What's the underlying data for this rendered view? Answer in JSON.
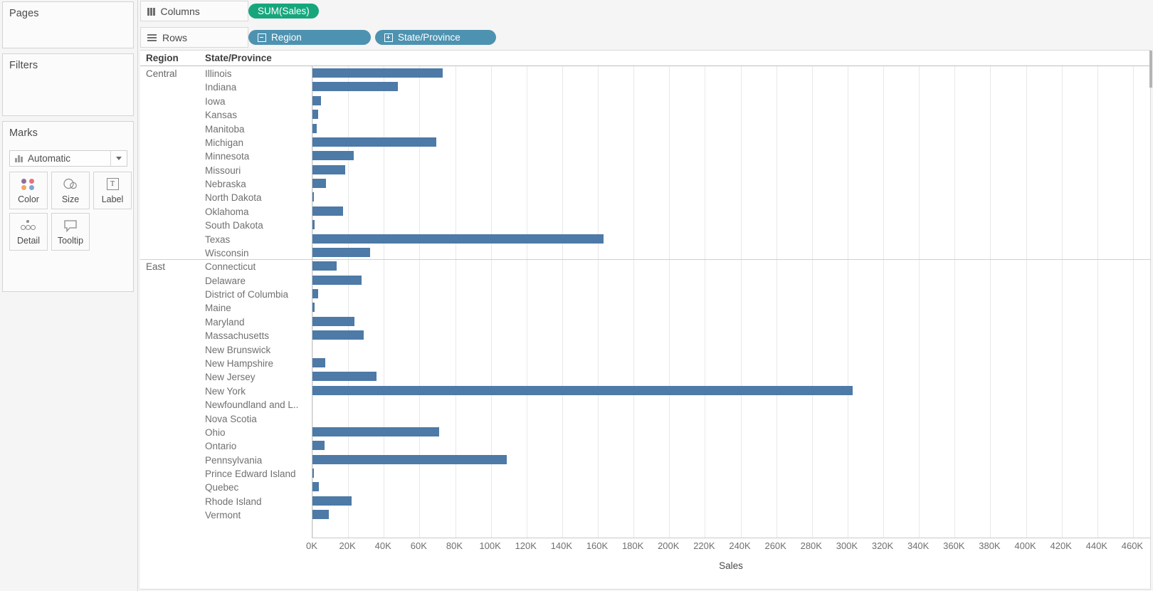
{
  "panel": {
    "pages_title": "Pages",
    "filters_title": "Filters",
    "marks_title": "Marks",
    "marks_type": "Automatic",
    "marks_type_icon": "bar-chart-icon",
    "mark_buttons": [
      {
        "label": "Color",
        "icon": "color-dots-icon"
      },
      {
        "label": "Size",
        "icon": "size-circles-icon"
      },
      {
        "label": "Label",
        "icon": "label-text-icon"
      },
      {
        "label": "Detail",
        "icon": "detail-dots-icon"
      },
      {
        "label": "Tooltip",
        "icon": "tooltip-bubble-icon"
      }
    ],
    "color_dots": [
      "#8d6e9e",
      "#e8717e",
      "#f0a868",
      "#7aa6d2"
    ]
  },
  "shelves": {
    "columns_label": "Columns",
    "columns_icon": "columns-icon",
    "rows_label": "Rows",
    "rows_icon": "rows-icon",
    "columns_pills": [
      {
        "text": "SUM(Sales)",
        "color": "#17a67c",
        "expander": "none"
      }
    ],
    "rows_pills": [
      {
        "text": "Region",
        "color": "#4d92b0",
        "expander": "minus"
      },
      {
        "text": "State/Province",
        "color": "#4d92b0",
        "expander": "plus"
      }
    ]
  },
  "headers": {
    "region": "Region",
    "state": "State/Province"
  },
  "chart_data": {
    "type": "bar",
    "title": "",
    "orientation": "horizontal",
    "xlabel": "Sales",
    "ylabel": "",
    "xlim": [
      0,
      470
    ],
    "units": "K",
    "grid": true,
    "legend": "none",
    "bar_color": "#4d7aa7",
    "tick_labels": [
      "0K",
      "20K",
      "40K",
      "60K",
      "80K",
      "100K",
      "120K",
      "140K",
      "160K",
      "180K",
      "200K",
      "220K",
      "240K",
      "260K",
      "280K",
      "300K",
      "320K",
      "340K",
      "360K",
      "380K",
      "400K",
      "420K",
      "440K",
      "460K"
    ],
    "tick_values": [
      0,
      20,
      40,
      60,
      80,
      100,
      120,
      140,
      160,
      180,
      200,
      220,
      240,
      260,
      280,
      300,
      320,
      340,
      360,
      380,
      400,
      420,
      440,
      460
    ],
    "groups": [
      {
        "region": "Central",
        "rows": [
          {
            "state": "Illinois",
            "value": 73.0
          },
          {
            "state": "Indiana",
            "value": 48.0
          },
          {
            "state": "Iowa",
            "value": 4.6
          },
          {
            "state": "Kansas",
            "value": 3.0
          },
          {
            "state": "Manitoba",
            "value": 2.2
          },
          {
            "state": "Michigan",
            "value": 69.5
          },
          {
            "state": "Minnesota",
            "value": 23.0
          },
          {
            "state": "Missouri",
            "value": 18.5
          },
          {
            "state": "Nebraska",
            "value": 7.5
          },
          {
            "state": "North Dakota",
            "value": 0.6
          },
          {
            "state": "Oklahoma",
            "value": 17.0
          },
          {
            "state": "South Dakota",
            "value": 1.3
          },
          {
            "state": "Texas",
            "value": 163.0
          },
          {
            "state": "Wisconsin",
            "value": 32.5
          }
        ]
      },
      {
        "region": "East",
        "rows": [
          {
            "state": "Connecticut",
            "value": 13.4
          },
          {
            "state": "Delaware",
            "value": 27.5
          },
          {
            "state": "District of Columbia",
            "value": 3.0
          },
          {
            "state": "Maine",
            "value": 1.2
          },
          {
            "state": "Maryland",
            "value": 23.7
          },
          {
            "state": "Massachusetts",
            "value": 28.6
          },
          {
            "state": "New Brunswick",
            "value": 0.0
          },
          {
            "state": "New Hampshire",
            "value": 7.3
          },
          {
            "state": "New Jersey",
            "value": 35.8
          },
          {
            "state": "New York",
            "value": 303.0
          },
          {
            "state": "Newfoundland and L..",
            "value": 0.0
          },
          {
            "state": "Nova Scotia",
            "value": 0.0
          },
          {
            "state": "Ohio",
            "value": 71.0
          },
          {
            "state": "Ontario",
            "value": 6.6
          },
          {
            "state": "Pennsylvania",
            "value": 109.0
          },
          {
            "state": "Prince Edward Island",
            "value": 0.5
          },
          {
            "state": "Quebec",
            "value": 3.4
          },
          {
            "state": "Rhode Island",
            "value": 22.0
          },
          {
            "state": "Vermont",
            "value": 9.0
          }
        ]
      }
    ]
  }
}
